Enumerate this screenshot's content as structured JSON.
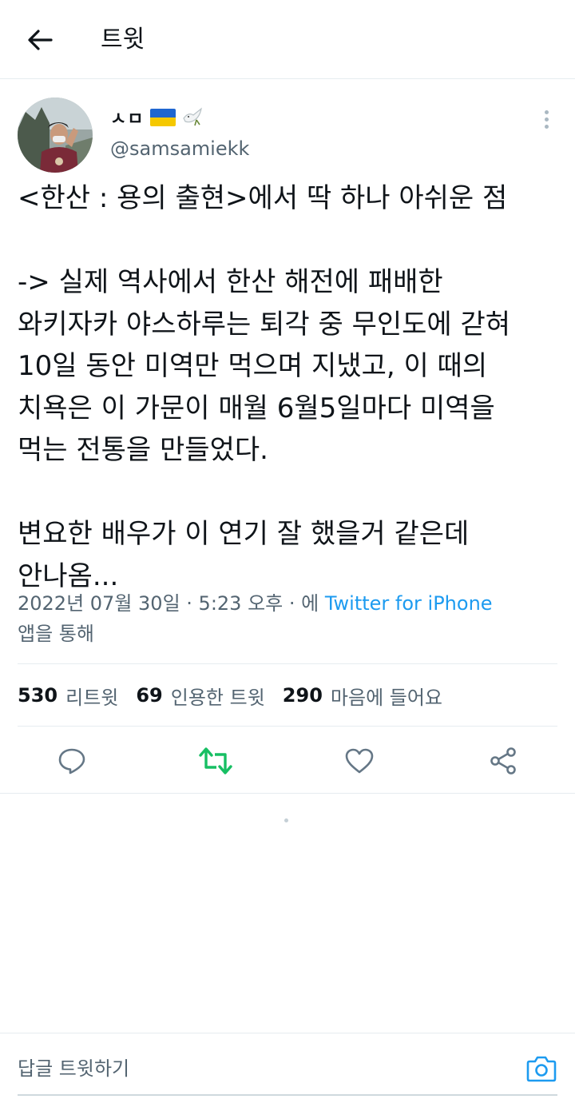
{
  "header": {
    "back_icon": "arrow-left-icon",
    "title": "트윗"
  },
  "tweet": {
    "author": {
      "display_name": "ㅅㅁ",
      "emoji": [
        "ukraine-flag-icon",
        "dove-icon"
      ],
      "handle": "@samsamiekk"
    },
    "text": "<한산 : 용의 출현>에서 딱 하나 아쉬운 점\n\n-> 실제 역사에서 한산 해전에 패배한\n와키자카 야스하루는 퇴각 중 무인도에 갇혀\n10일 동안 미역만 먹으며 지냈고, 이 때의\n치욕은 이 가문이 매월 6월5일마다 미역을\n먹는 전통을 만들었다.\n\n변요한 배우가 이 연기 잘 했을거 같은데\n안나옴...",
    "meta": {
      "date": "2022년 07월 30일",
      "sep1": " · ",
      "time": "5:23 오후",
      "sep2": " · 에 ",
      "source": "Twitter for iPhone",
      "suffix": "앱을 통해"
    },
    "stats": {
      "retweets_count": "530",
      "retweets_label": "리트윗",
      "quotes_count": "69",
      "quotes_label": "인용한 트윗",
      "likes_count": "290",
      "likes_label": "마음에 들어요"
    },
    "actions": [
      "reply-icon",
      "retweet-icon",
      "like-icon",
      "share-icon"
    ]
  },
  "reply_bar": {
    "placeholder": "답글 트윗하기",
    "camera_icon": "camera-icon"
  },
  "colors": {
    "text": "#0f1419",
    "secondary": "#536471",
    "link": "#1d9bf0",
    "retweet_green": "#17bf63",
    "icon": "#657786",
    "divider": "#e6ecf0"
  }
}
